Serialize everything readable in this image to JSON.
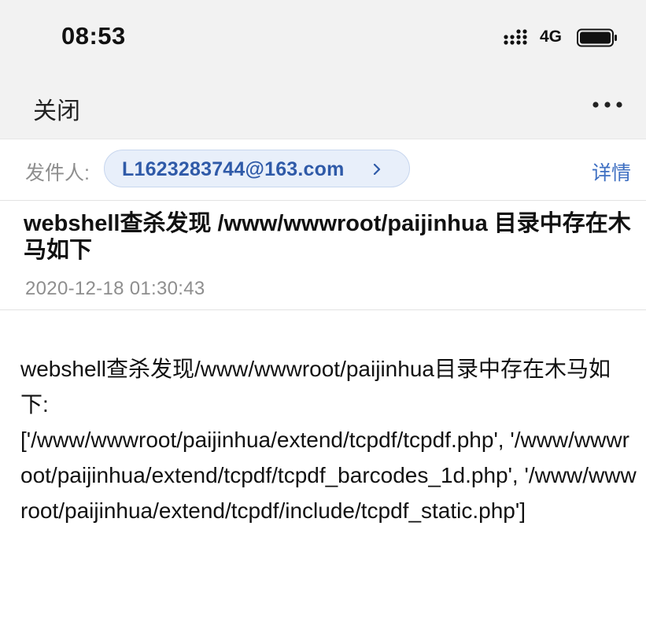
{
  "status_bar": {
    "time": "08:53",
    "network": "4G",
    "signal_icon": "cellular-signal-icon",
    "battery_icon": "battery-icon"
  },
  "nav": {
    "close_label": "关闭",
    "more_icon": "more-horizontal-icon"
  },
  "sender": {
    "label": "发件人:",
    "email": "L1623283744@163.com",
    "detail_label": "详情"
  },
  "email": {
    "subject": "webshell查杀发现 /www/wwwroot/paijinhua 目录中存在木马如下",
    "date": "2020-12-18 01:30:43",
    "body": "webshell查杀发现/www/wwwroot/paijinhua目录中存在木马如下:\n['/www/wwwroot/paijinhua/extend/tcpdf/tcpdf.php', '/www/wwwroot/paijinhua/extend/tcpdf/tcpdf_barcodes_1d.php', '/www/wwwroot/paijinhua/extend/tcpdf/include/tcpdf_static.php']"
  },
  "colors": {
    "accent": "#3e6fc2",
    "pill_bg": "#e8effa",
    "header_bg": "#f2f2f2"
  }
}
